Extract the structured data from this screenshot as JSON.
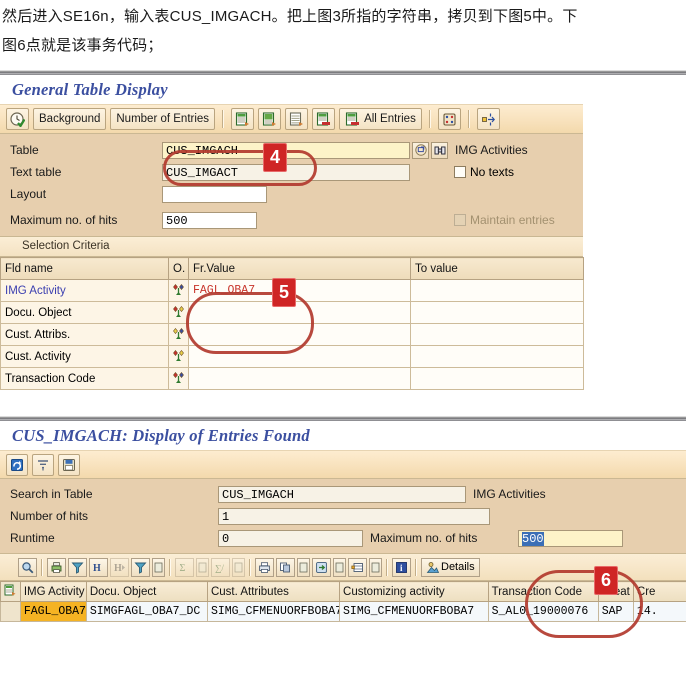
{
  "instruction": {
    "line1": "然后进入SE16n，输入表CUS_IMGACH。把上图3所指的字符串，拷贝到下图5中。下",
    "line2": "图6点就是该事务代码；"
  },
  "window1": {
    "title": "General Table Display",
    "toolbar": {
      "execute_icon": "clock-check-icon",
      "background_label": "Background",
      "number_of_entries_label": "Number of Entries",
      "icon1": "table-entries-icon",
      "icon2": "table-entries-green-icon",
      "icon3": "table-list-icon",
      "icon4": "table-red-icon",
      "all_entries_icon": "table-all-entries-icon",
      "all_entries_label": "All Entries",
      "icon6": "settings-dice-icon",
      "icon7": "expand-arrows-icon"
    },
    "form": {
      "table_label": "Table",
      "table_value": "CUS_IMGACH",
      "table_side_icon1": "open-window-icon",
      "table_side_icon2": "binoculars-icon",
      "table_side_text": "IMG Activities",
      "text_table_label": "Text table",
      "text_table_value": "CUS_IMGACT",
      "no_texts_label": "No texts",
      "layout_label": "Layout",
      "layout_value": "",
      "max_hits_label": "Maximum no. of hits",
      "max_hits_value": "500",
      "maintain_entries_label": "Maintain entries"
    },
    "selection": {
      "group_title": "Selection Criteria",
      "columns": [
        "Fld name",
        "O.",
        "Fr.Value",
        "To value"
      ],
      "rows": [
        {
          "fld": "IMG Activity",
          "op_icon": "select-options-icon",
          "from": "FAGL_OBA7",
          "to": ""
        },
        {
          "fld": "Docu. Object",
          "op_icon": "select-options-icon",
          "from": "",
          "to": ""
        },
        {
          "fld": "Cust. Attribs.",
          "op_icon": "select-options-icon",
          "from": "",
          "to": ""
        },
        {
          "fld": "Cust. Activity",
          "op_icon": "select-options-icon",
          "from": "",
          "to": ""
        },
        {
          "fld": "Transaction Code",
          "op_icon": "select-options-icon",
          "from": "",
          "to": ""
        }
      ]
    }
  },
  "window2": {
    "title": "CUS_IMGACH: Display of Entries Found",
    "toolbar": {
      "icon1": "refresh-icon",
      "icon2": "sort-filter-icon",
      "icon3": "save-layout-icon"
    },
    "form": {
      "search_in_table_label": "Search in Table",
      "search_in_table_value": "CUS_IMGACH",
      "search_in_table_side": "IMG Activities",
      "number_of_hits_label": "Number of hits",
      "number_of_hits_value": "1",
      "runtime_label": "Runtime",
      "runtime_value": "0",
      "max_hits_label": "Maximum no. of hits",
      "max_hits_value": "500"
    },
    "alv_toolbar": {
      "icons": [
        "magnifier-icon",
        "print-preview-icon",
        "filter-icon",
        "find-icon",
        "find-next-icon",
        "filter-set-icon",
        "filter-more-icon",
        "sum-icon",
        "sum-more-icon",
        "subtotal-icon",
        "subtotal-more-icon",
        "print-icon",
        "export-icon",
        "export-more-icon",
        "local-file-icon",
        "local-file-more-icon",
        "spreadsheet-icon",
        "spreadsheet-more-icon",
        "info-icon"
      ],
      "details_icon": "details-person-icon",
      "details_label": "Details"
    },
    "grid": {
      "columns": [
        "IMG Activity",
        "Docu. Object",
        "Cust. Attributes",
        "Customizing activity",
        "Transaction Code",
        "Creat",
        "Cre"
      ],
      "row_icon": "row-detail-icon",
      "rows": [
        {
          "img_activity": "FAGL_OBA7",
          "docu_object": "SIMGFAGL_OBA7_DC",
          "cust_attributes": "SIMG_CFMENUORFBOBA7",
          "customizing_activity": "SIMG_CFMENUORFBOBA7",
          "transaction_code": "S_AL0_19000076",
          "creat": "SAP",
          "cre": "14."
        }
      ]
    }
  },
  "annotations": {
    "marker4": "4",
    "marker5": "5",
    "marker6": "6"
  },
  "colors": {
    "accent_title": "#3b4fa0",
    "annotation_red": "#cf2525",
    "annotation_circle": "#b23a2e",
    "key_cell": "#f5b323",
    "focus_field": "#fdf3c8",
    "form_bg": "#e7cfae",
    "toolbar_bg": "#f8e2bd"
  }
}
